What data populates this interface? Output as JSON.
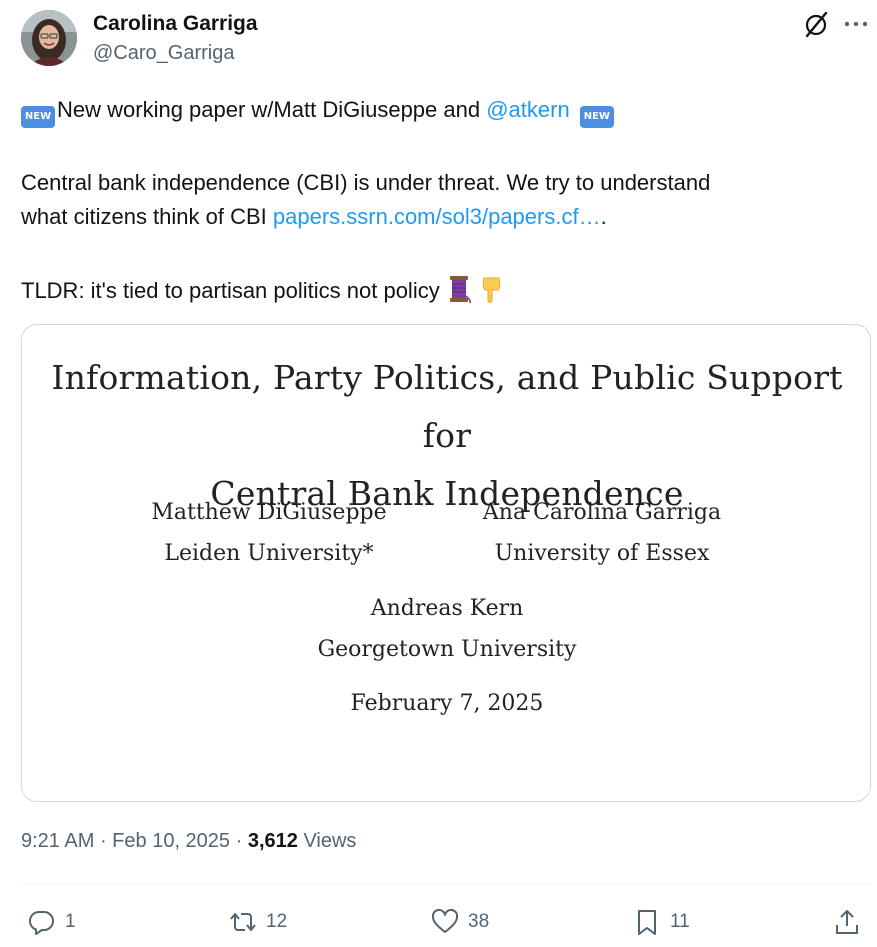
{
  "author": {
    "name": "Carolina Garriga",
    "handle": "@Caro_Garriga"
  },
  "tweet": {
    "badge": "NEW",
    "line1_text": "New working paper w/Matt DiGiuseppe and ",
    "line1_mention": "@atkern",
    "line2": "Central bank independence (CBI) is under threat. We try to understand",
    "line3_text": "what citizens think of CBI ",
    "line3_link": "papers.ssrn.com/sol3/papers.cf…",
    "line3_tail": ".",
    "line4": "TLDR: it's tied to partisan politics not policy",
    "emojis": [
      "thread-spool-emoji",
      "pointing-down-emoji"
    ]
  },
  "paper": {
    "title_line1": "Information, Party Politics, and Public Support for",
    "title_line2": "Central Bank Independence",
    "author1_name": "Matthew DiGiuseppe",
    "author1_affil": "Leiden University*",
    "author2_name": "Ana Carolina Garriga",
    "author2_affil": "University of Essex",
    "author3_name": "Andreas Kern",
    "author3_affil": "Georgetown University",
    "date": "February 7, 2025"
  },
  "meta": {
    "time": "9:21 AM",
    "sep1": " · ",
    "date": "Feb 10, 2025",
    "sep2": " · ",
    "views_count": "3,612",
    "views_label": " Views"
  },
  "actions": {
    "replies": "1",
    "reposts": "12",
    "likes": "38",
    "bookmarks": "11"
  },
  "colors": {
    "link": "#1d9bf0",
    "secondary_text": "#536471",
    "primary_text": "#0f1419",
    "border": "#cfd9de"
  }
}
